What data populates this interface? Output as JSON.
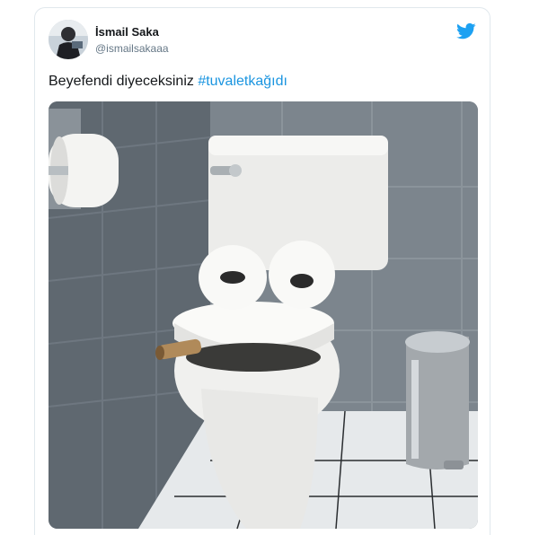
{
  "tweet": {
    "display_name": "İsmail Saka",
    "handle": "@ismailsakaaa",
    "text": "Beyefendi diyeceksiniz ",
    "hashtag": "#tuvaletkağıdı"
  },
  "icons": {
    "brand": "twitter-bird-icon",
    "brand_color": "#1da1f2"
  },
  "colors": {
    "hashtag": "#1b95e0",
    "name": "#14171a",
    "handle": "#657786"
  }
}
